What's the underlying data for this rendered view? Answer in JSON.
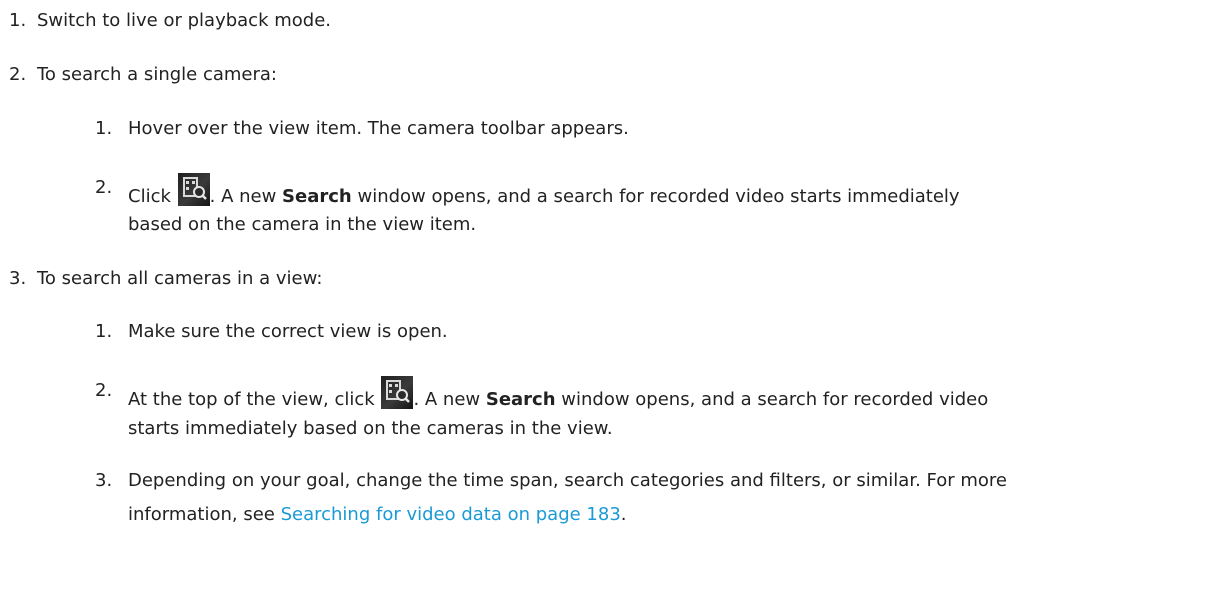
{
  "steps": [
    {
      "num": "1.",
      "text": "Switch to live or playback mode."
    },
    {
      "num": "2.",
      "text": "To search a single camera:",
      "substeps": [
        {
          "num": "1.",
          "text": "Hover over the view item. The camera toolbar appears."
        },
        {
          "num": "2.",
          "before": "Click",
          "icon": "search-video-icon",
          "mid": ". A new",
          "bold": "Search",
          "after": "window opens, and a search for recorded video starts immediately",
          "line2": "based on the camera in the view item."
        }
      ]
    },
    {
      "num": "3.",
      "text": "To search all cameras in a view:",
      "substeps": [
        {
          "num": "1.",
          "text": "Make sure the correct view is open."
        },
        {
          "num": "2.",
          "before": "At the top of the view, click",
          "icon": "search-video-icon",
          "mid": ". A new",
          "bold": "Search",
          "after": "window opens, and a search for recorded video",
          "line2": "starts immediately based on the cameras in the view."
        },
        {
          "num": "3.",
          "text": "Depending on your goal, change the time span, search categories and filters, or similar. For more",
          "line2_before": "information, see",
          "link": "Searching for video data on page 183",
          "line2_after": "."
        }
      ]
    }
  ],
  "colors": {
    "text": "#222222",
    "link": "#1a9ad6",
    "icon_bg": "#2a2a2a"
  }
}
